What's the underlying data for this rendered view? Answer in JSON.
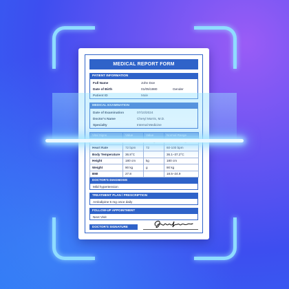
{
  "form": {
    "title": "MEDICAL REPORT FORM",
    "patient": {
      "header": "PATIENT INFORMATION",
      "full_name_label": "Full Name",
      "full_name": "John Doe",
      "dob_label": "Date of Birth",
      "dob": "01/05/1980",
      "gender_label": "Gender",
      "patient_id_label": "Patient ID",
      "patient_id": "Male"
    },
    "exam": {
      "header": "MEDICAL EXAMINATION",
      "date_label": "Date of Examination",
      "date": "07/10/2024",
      "doctor_label": "Doctor's Name",
      "doctor": "Cheryl Morris, M.D.",
      "specialty_label": "Specialty",
      "specialty": "Internal Medicine"
    },
    "vitals": {
      "headers": [
        "Vital Signs",
        "Value",
        "Value",
        "Normal Range"
      ],
      "rows": [
        [
          "Blood Pressure",
          "120/50 mx",
          "mmHg",
          "120/80 mmHg"
        ],
        [
          "Heart Rate",
          "72 bpm",
          "72",
          "60-100 bpm"
        ],
        [
          "Body Temperature",
          "36.8°C",
          "",
          "36.1–37.2°C"
        ],
        [
          "Height",
          "180 cm",
          "kg",
          "180 cm"
        ],
        [
          "Weight",
          "90 kg",
          "g",
          "90 kg"
        ],
        [
          "BMI",
          "27.8",
          "",
          "18.5–24.9"
        ]
      ]
    },
    "diagnosis": {
      "header": "DOCTOR'S DIAGNOSIS",
      "text": "Mild hypertension"
    },
    "treatment": {
      "header": "TREATMENT PLAN / PRESCRIPTION",
      "text": "Amlodipine 5 mg once daily"
    },
    "followup": {
      "header": "FOLLOW-UP APPOINTMENT",
      "text": "Next Visit"
    },
    "signature": {
      "header": "DOCTOR'S SIGNATURE"
    }
  },
  "colors": {
    "accent": "#2f63c9",
    "scan": "#8fdcff"
  }
}
